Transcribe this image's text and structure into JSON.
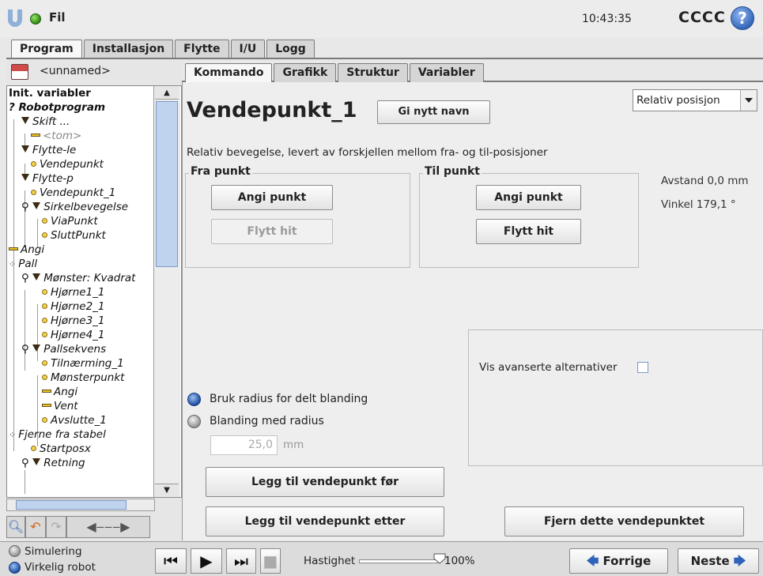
{
  "header": {
    "file_menu": "Fil",
    "clock": "10:43:35",
    "robot_name": "CCCC",
    "help": "?"
  },
  "main_tabs": [
    "Program",
    "Installasjon",
    "Flytte",
    "I/U",
    "Logg"
  ],
  "main_tabs_active": 0,
  "program": {
    "name": "<unnamed>"
  },
  "tree": [
    {
      "label": "Init. variabler",
      "style": "bold"
    },
    {
      "label": "Robotprogram",
      "style": "bold-it"
    },
    {
      "label": "Skift ...",
      "style": "it"
    },
    {
      "label": "<tom>",
      "style": "grey"
    },
    {
      "label": "Flytte-le",
      "style": "it"
    },
    {
      "label": "Vendepunkt",
      "style": "it"
    },
    {
      "label": "Flytte-p",
      "style": "it"
    },
    {
      "label": "Vendepunkt_1",
      "style": "sel"
    },
    {
      "label": "Sirkelbevegelse",
      "style": "it"
    },
    {
      "label": "ViaPunkt",
      "style": "it"
    },
    {
      "label": "SluttPunkt",
      "style": "it"
    },
    {
      "label": "Angi",
      "style": "it"
    },
    {
      "label": "Pall",
      "style": "it"
    },
    {
      "label": "Mønster: Kvadrat",
      "style": "it"
    },
    {
      "label": "Hjørne1_1",
      "style": "it"
    },
    {
      "label": "Hjørne2_1",
      "style": "it"
    },
    {
      "label": "Hjørne3_1",
      "style": "it"
    },
    {
      "label": "Hjørne4_1",
      "style": "it"
    },
    {
      "label": "Pallsekvens",
      "style": "it"
    },
    {
      "label": "Tilnærming_1",
      "style": "it"
    },
    {
      "label": "Mønsterpunkt",
      "style": "it"
    },
    {
      "label": "Angi",
      "style": "it"
    },
    {
      "label": "Vent",
      "style": "it"
    },
    {
      "label": "Avslutte_1",
      "style": "it"
    },
    {
      "label": "Fjerne fra stabel",
      "style": "it"
    },
    {
      "label": "Startposx",
      "style": "it"
    },
    {
      "label": "Retning",
      "style": "it"
    }
  ],
  "sub_tabs": [
    "Kommando",
    "Grafikk",
    "Struktur",
    "Variabler"
  ],
  "sub_tabs_active": 0,
  "waypoint": {
    "title": "Vendepunkt_1",
    "rename_button": "Gi nytt navn",
    "position_mode": "Relativ posisjon",
    "description": "Relativ bevegelse, levert av forskjellen mellom fra- og til-posisjoner",
    "from_group": "Fra punkt",
    "to_group": "Til punkt",
    "set_point": "Angi punkt",
    "move_here": "Flytt hit",
    "distance": "Avstand 0,0 mm",
    "angle": "Vinkel 179,1 °",
    "advanced_options": "Vis avanserte alternativer",
    "advanced_checked": false,
    "blend_shared": "Bruk radius for delt blanding",
    "blend_radius": "Blanding med radius",
    "blend_selected": "shared",
    "radius_value": "25,0",
    "radius_unit": "mm",
    "add_before": "Legg til vendepunkt før",
    "add_after": "Legg til vendepunkt etter",
    "remove": "Fjern dette vendepunktet"
  },
  "footer": {
    "simulation": "Simulering",
    "real_robot": "Virkelig robot",
    "speed_label": "Hastighet",
    "speed_value": "100%",
    "speed_fraction": 1.0,
    "previous": "Forrige",
    "next": "Neste"
  },
  "colors": {
    "accent_blue": "#2f62b8",
    "status_green": "#2f8a17",
    "selection": "#c9dbf2"
  }
}
